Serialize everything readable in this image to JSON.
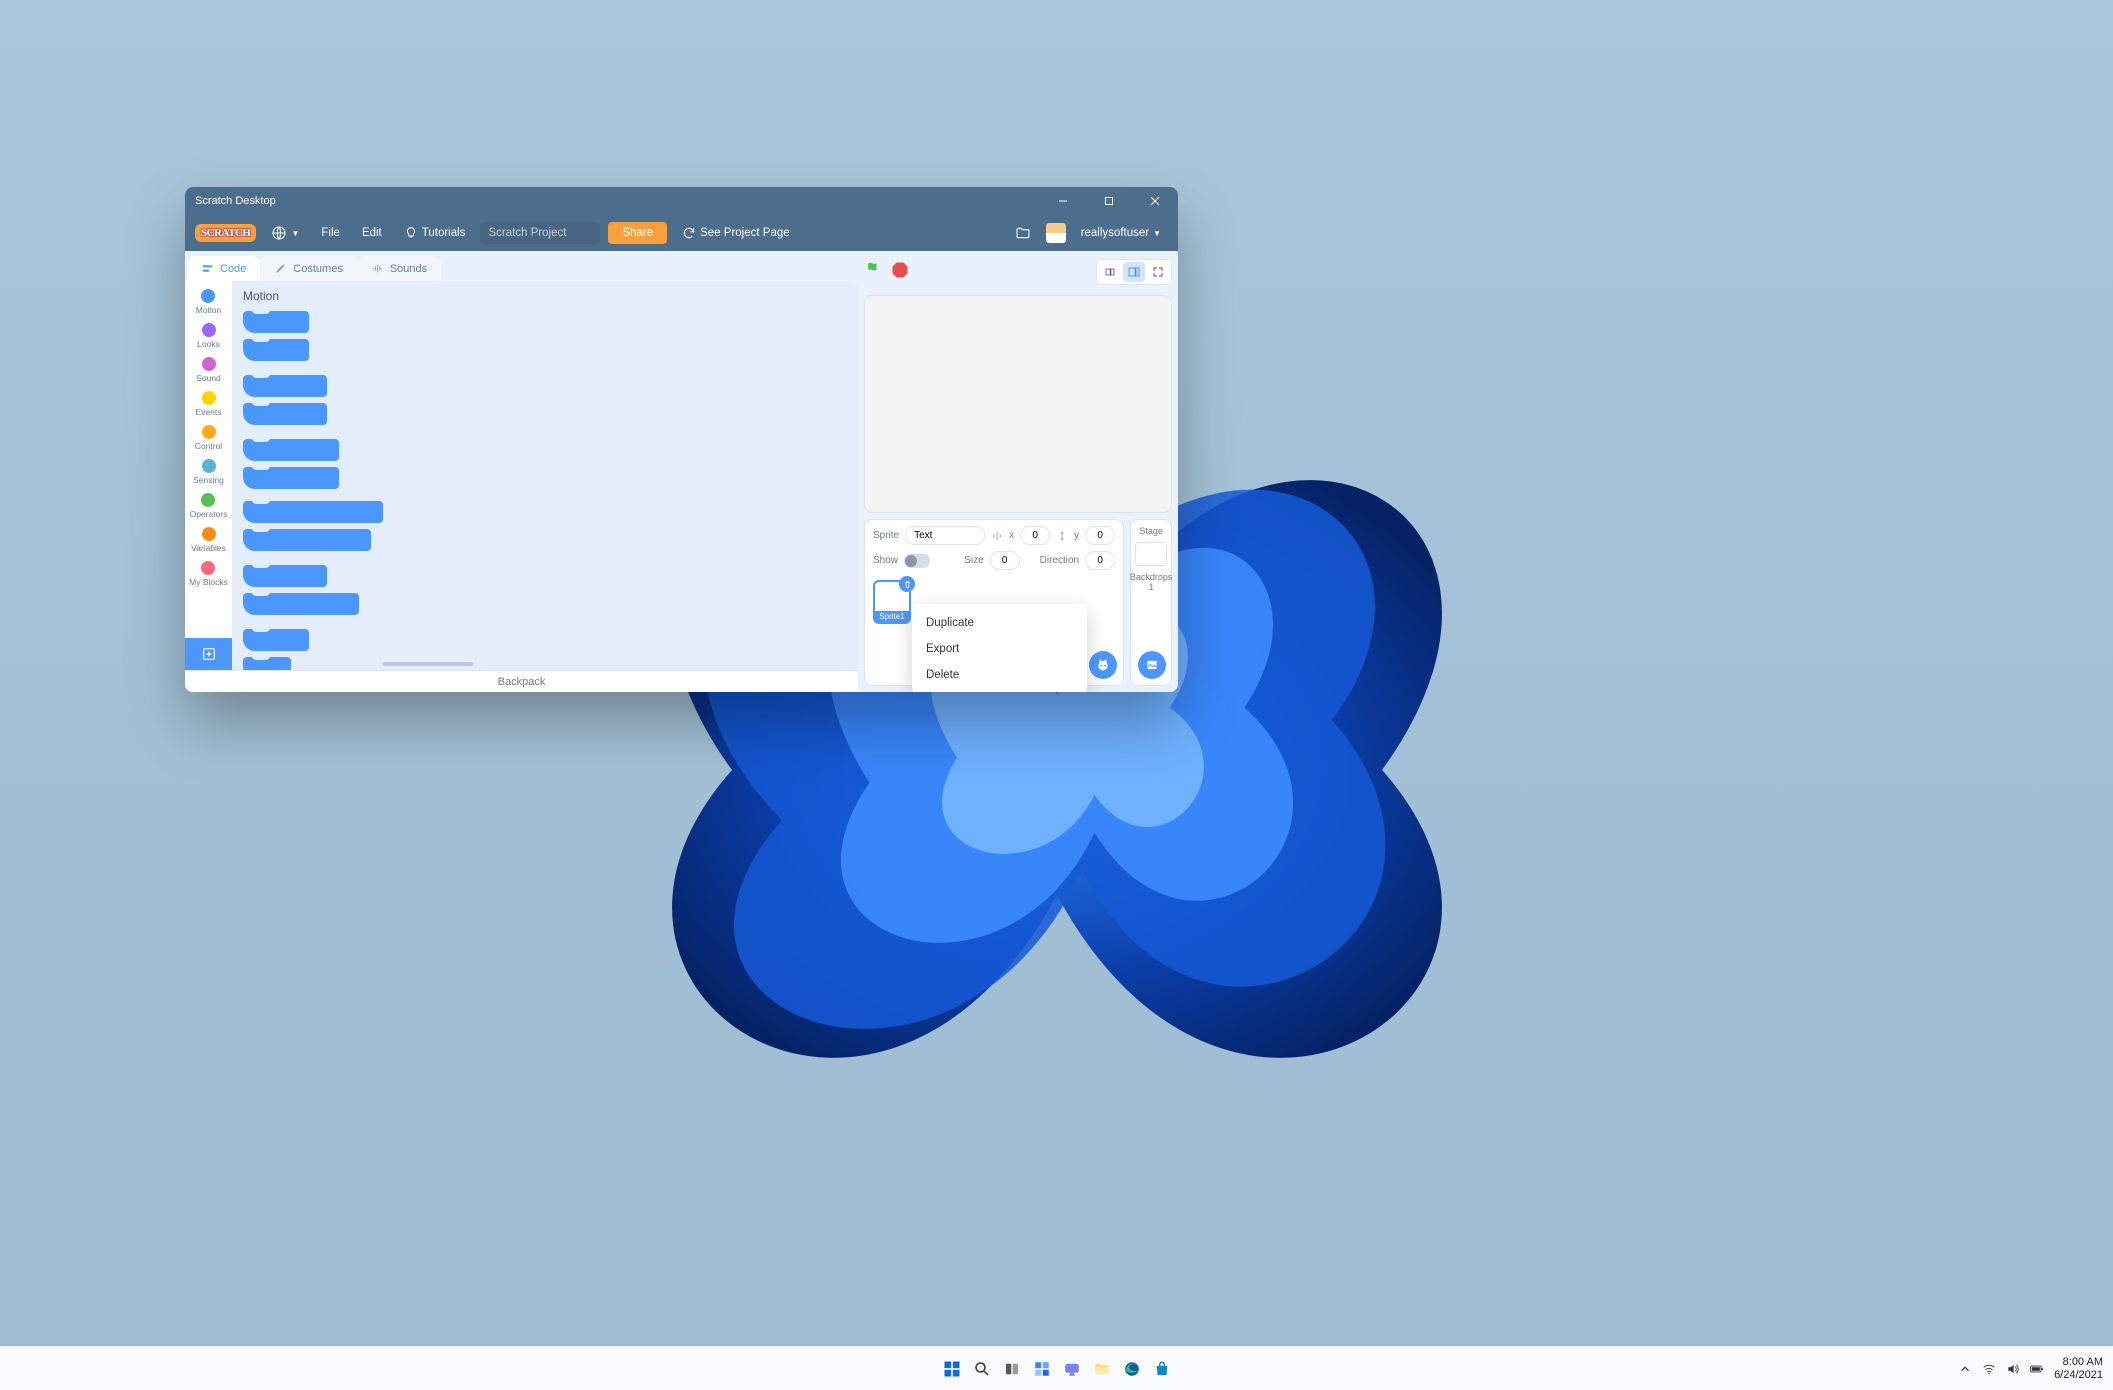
{
  "window": {
    "title": "Scratch Desktop"
  },
  "menubar": {
    "logo": "SCRATCH",
    "file": "File",
    "edit": "Edit",
    "tutorials": "Tutorials",
    "project_name": "Scratch Project",
    "share": "Share",
    "see_project": "See Project Page",
    "username": "reallysoftuser"
  },
  "tabs": {
    "code": "Code",
    "costumes": "Costumes",
    "sounds": "Sounds"
  },
  "categories": {
    "heading": "Motion",
    "items": [
      {
        "label": "Motion",
        "color": "#4c97ff"
      },
      {
        "label": "Looks",
        "color": "#9966ff"
      },
      {
        "label": "Sound",
        "color": "#cf63cf"
      },
      {
        "label": "Events",
        "color": "#ffd500"
      },
      {
        "label": "Control",
        "color": "#ffab19"
      },
      {
        "label": "Sensing",
        "color": "#5cb1d6"
      },
      {
        "label": "Operators",
        "color": "#59c059"
      },
      {
        "label": "Variables",
        "color": "#ff8c1a"
      },
      {
        "label": "My Blocks",
        "color": "#ff6680"
      }
    ]
  },
  "sprite": {
    "label": "Sprite",
    "name": "Text",
    "x_label": "x",
    "x": "0",
    "y_label": "y",
    "y": "0",
    "show_label": "Show",
    "size_label": "Size",
    "size": "0",
    "direction_label": "Direction",
    "direction": "0",
    "thumb_label": "Sprite1"
  },
  "stage_col": {
    "title": "Stage",
    "backdrops_label": "Backdrops",
    "backdrops_count": "1"
  },
  "context_menu": {
    "duplicate": "Duplicate",
    "export": "Export",
    "delete": "Delete"
  },
  "backpack": "Backpack",
  "taskbar": {
    "time": "8:00 AM",
    "date": "6/24/2021"
  }
}
